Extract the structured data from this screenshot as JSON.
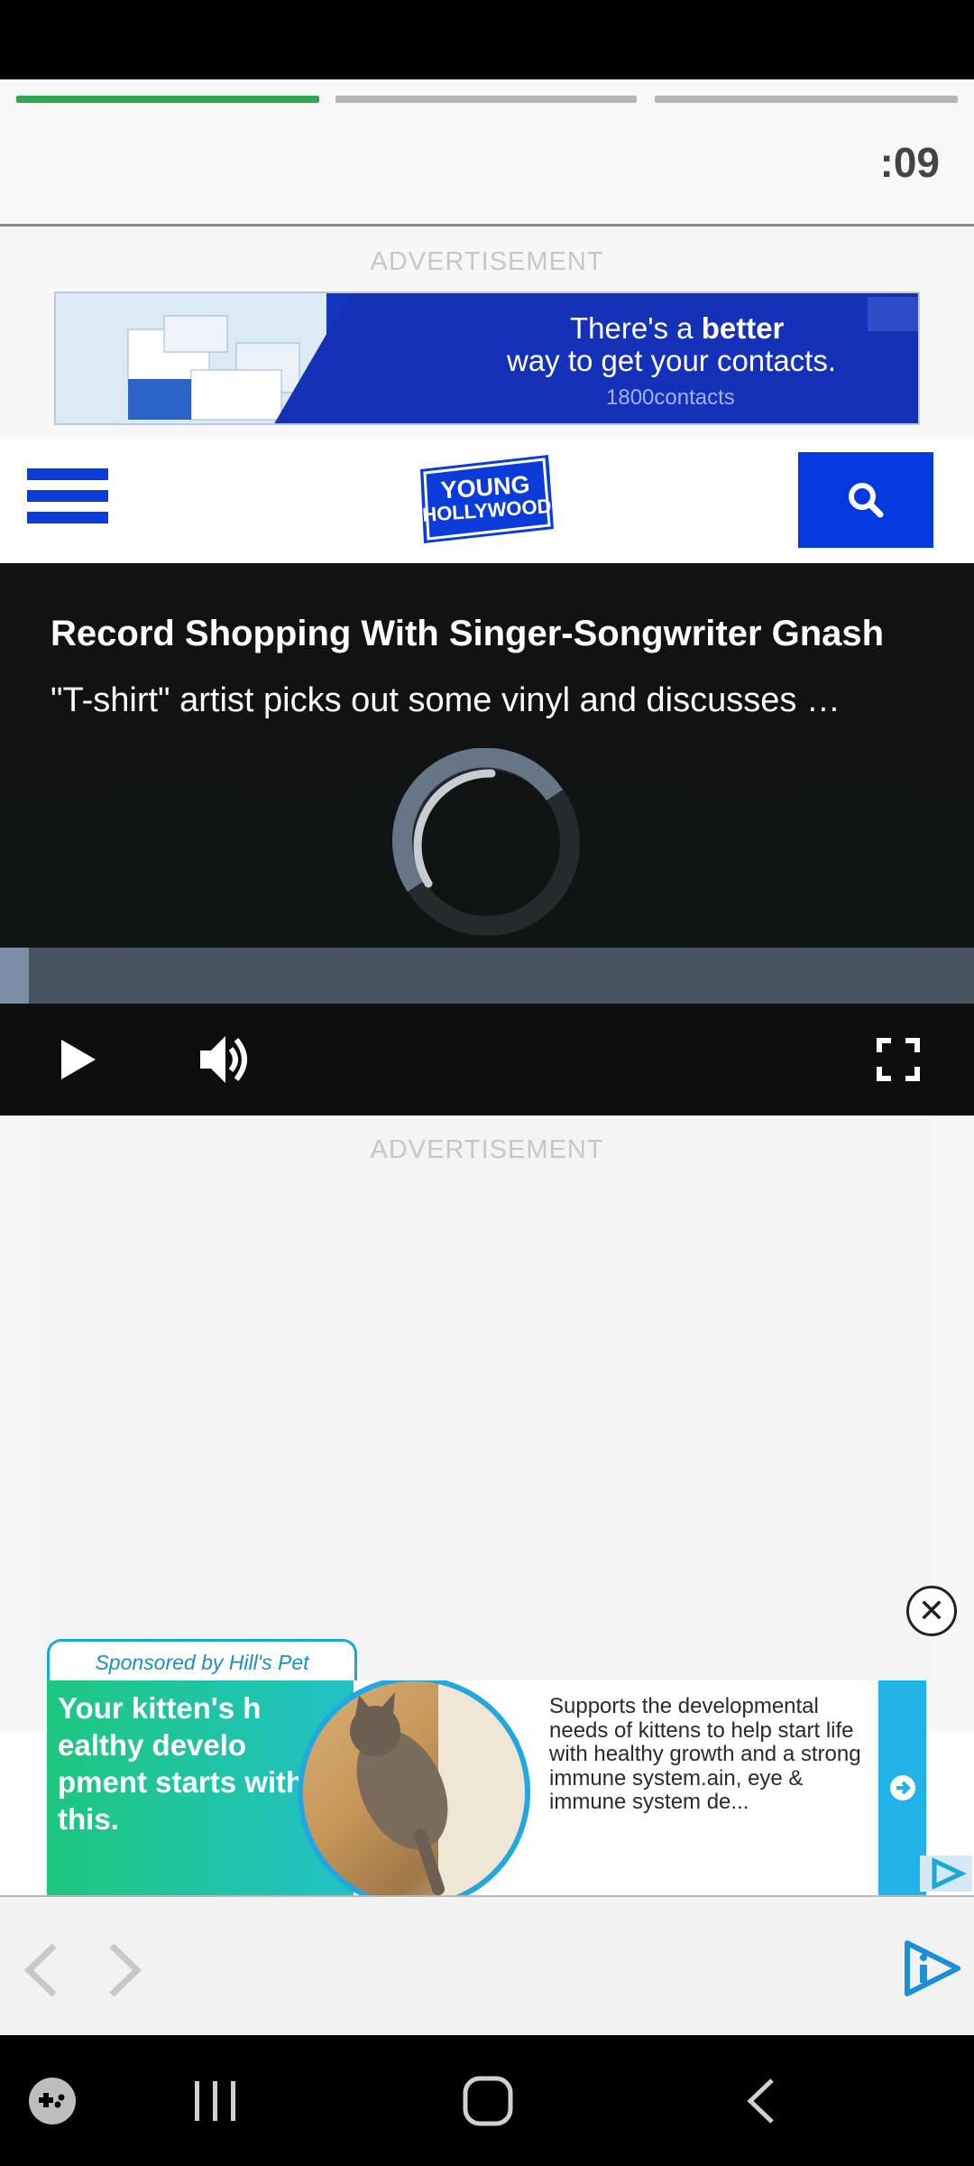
{
  "status_bar": {},
  "story": {
    "progress_segments": [
      1,
      0,
      0
    ],
    "timer": ":09"
  },
  "ads": {
    "top_label": "ADVERTISEMENT",
    "banner": {
      "line1_pre": "There's a ",
      "line1_bold": "better",
      "line2": "way to get your contacts.",
      "brand": "1800contacts"
    },
    "middle_label": "ADVERTISEMENT"
  },
  "header": {
    "logo_line1": "YOUNG",
    "logo_line2": "HOLLYWOOD",
    "menu_icon": "hamburger-icon",
    "search_icon": "search-icon"
  },
  "video": {
    "title": "Record Shopping With Singer-Songwriter Gnash",
    "description": "\"T-shirt\" artist picks out some vinyl and discusses …",
    "progress": 0.03,
    "controls": [
      "play-icon",
      "volume-icon",
      "fullscreen-icon"
    ]
  },
  "native_ad": {
    "sponsor": "Sponsored by Hill's Pet",
    "headline": "Your kitten's h ealthy develo pment starts with this.",
    "body": "Supports the developmental needs of kittens to help start life with healthy growth and a strong immune system.ain, eye & immune system de...",
    "close": "✕"
  },
  "browser": {
    "back_icon": "chevron-left-icon",
    "forward_icon": "chevron-right-icon",
    "brand_icon": "play-info-icon"
  },
  "system_nav": [
    "game-launcher-icon",
    "recent-apps-icon",
    "home-icon",
    "back-icon"
  ]
}
